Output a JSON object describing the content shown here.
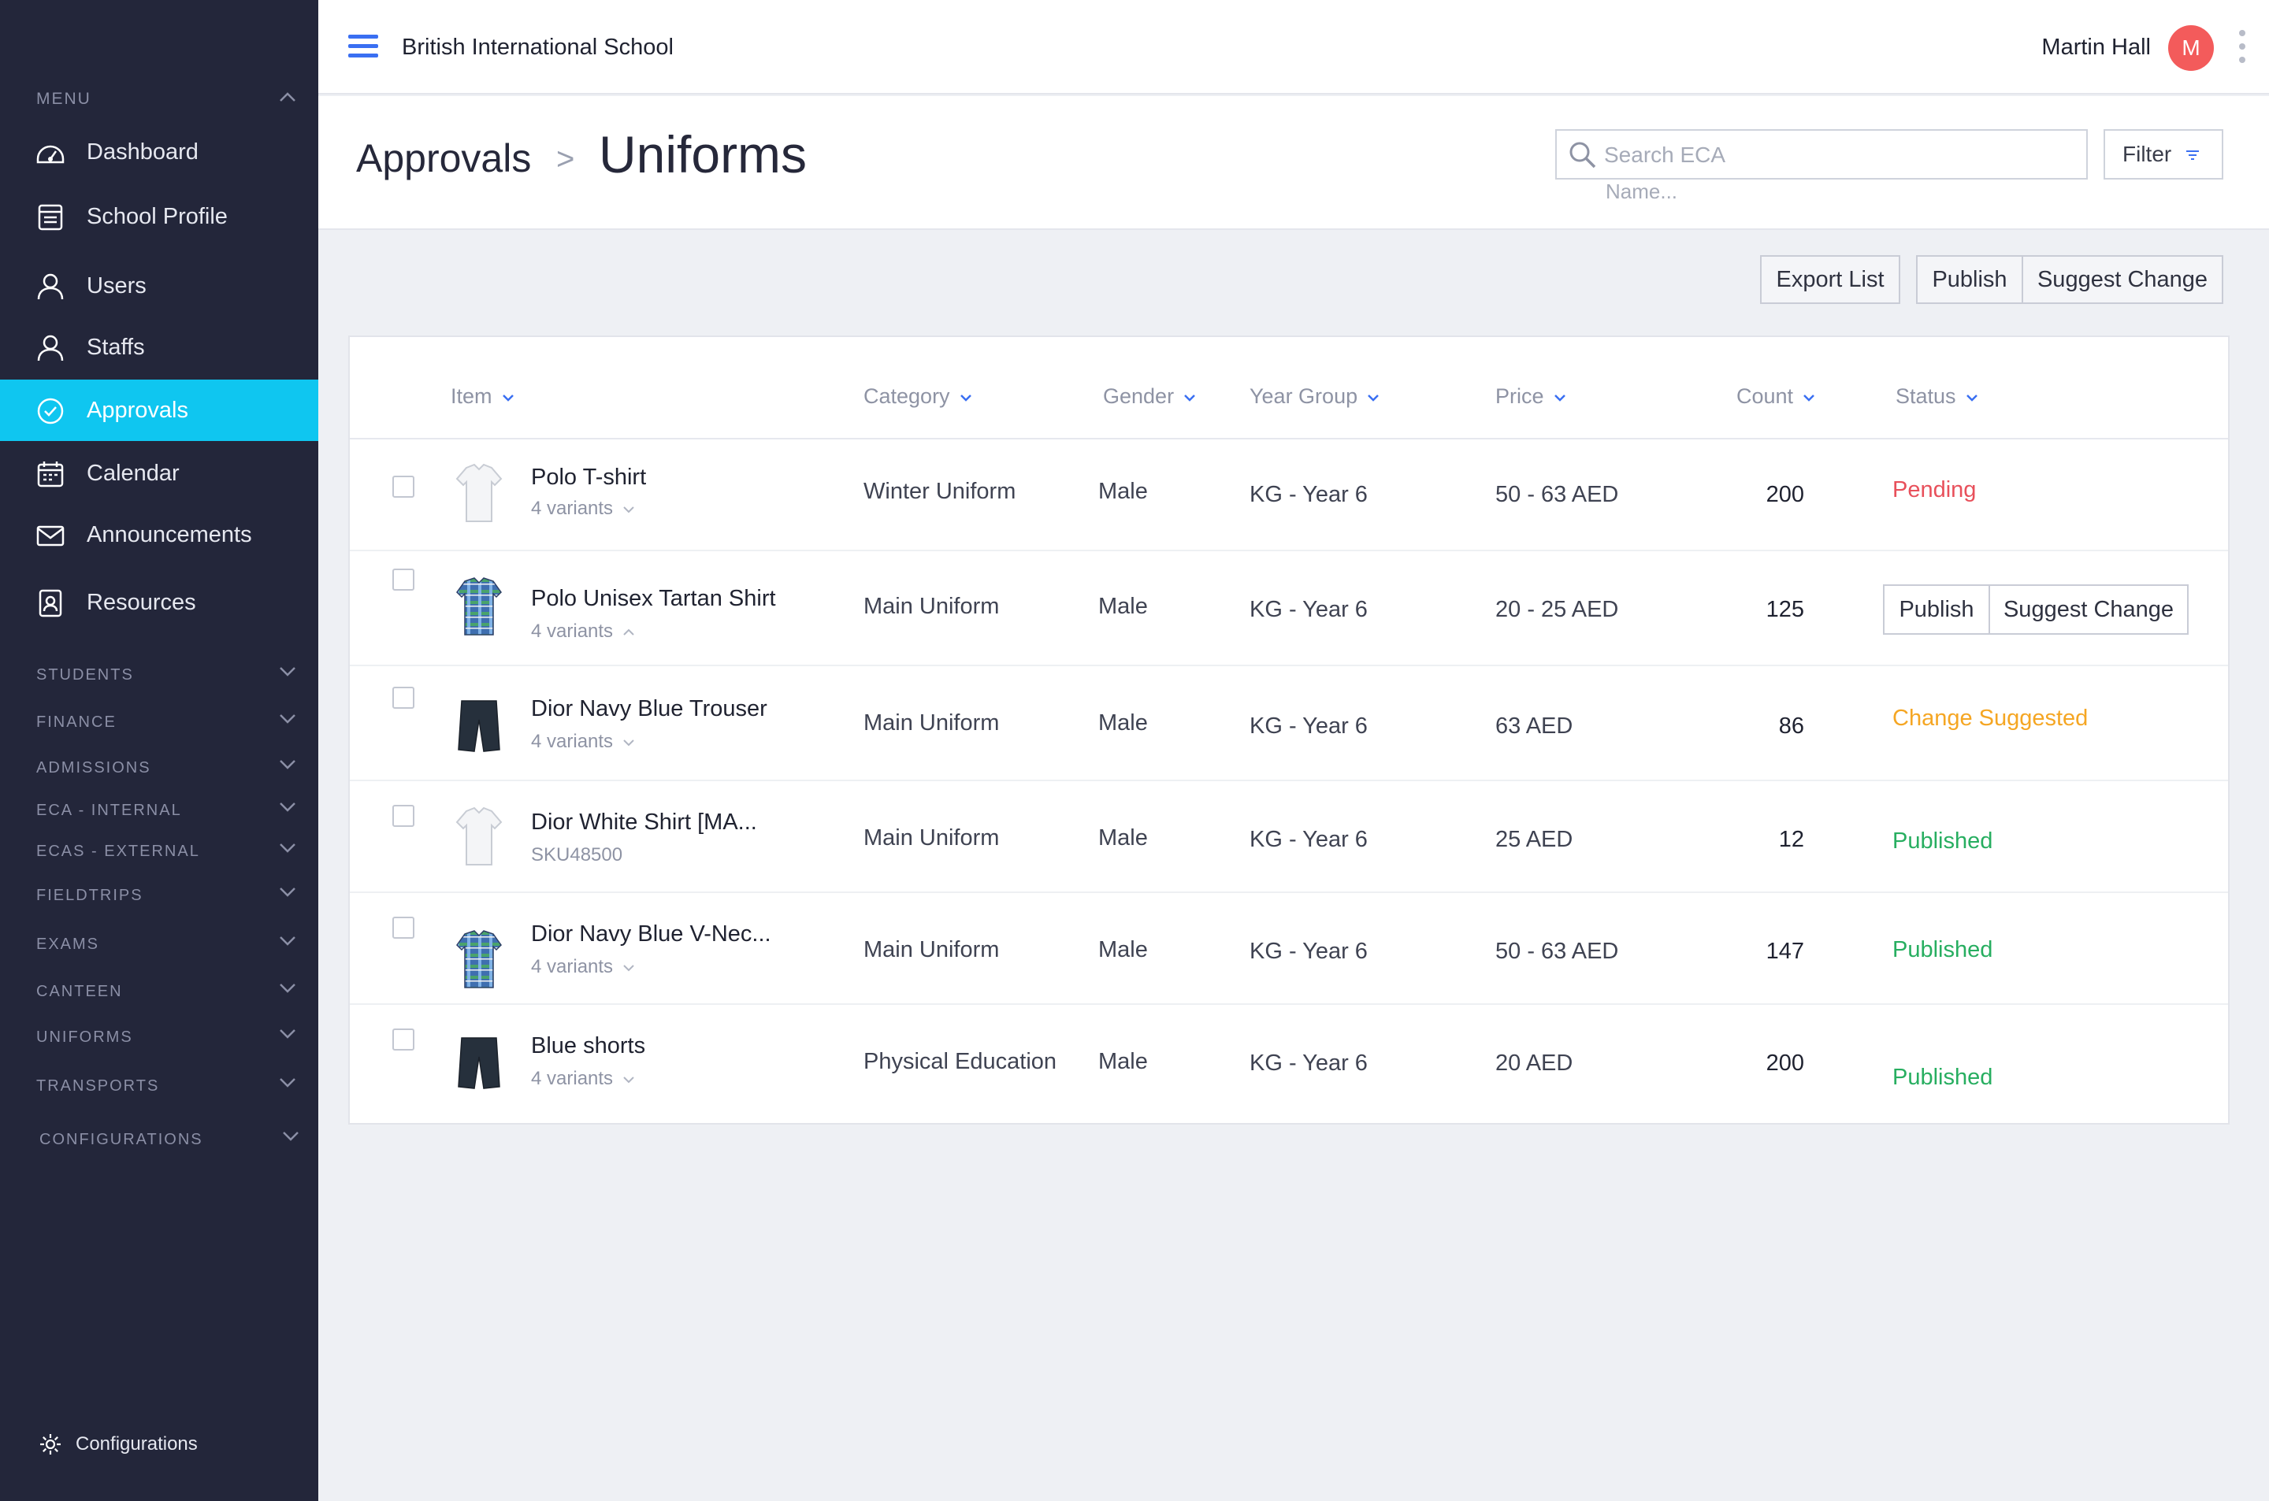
{
  "app": {
    "school_name": "British International School"
  },
  "user": {
    "name": "Martin Hall",
    "initial": "M"
  },
  "sidebar": {
    "menu_heading": "MENU",
    "items": [
      {
        "label": "Dashboard",
        "icon": "dashboard-icon"
      },
      {
        "label": "School Profile",
        "icon": "school-profile-icon"
      },
      {
        "label": "Users",
        "icon": "user-icon"
      },
      {
        "label": "Staffs",
        "icon": "staff-icon"
      },
      {
        "label": "Approvals",
        "icon": "check-circle-icon",
        "active": true
      },
      {
        "label": "Calendar",
        "icon": "calendar-icon"
      },
      {
        "label": "Announcements",
        "icon": "envelope-icon"
      },
      {
        "label": "Resources",
        "icon": "resources-icon"
      }
    ],
    "sections": [
      "STUDENTS",
      "FINANCE",
      "ADMISSIONS",
      "ECA - INTERNAL",
      "ECAS - EXTERNAL",
      "FIELDTRIPS",
      "EXAMS",
      "CANTEEN",
      "UNIFORMS",
      "TRANSPORTS",
      "CONFIGURATIONS"
    ],
    "footer_label": "Configurations"
  },
  "page": {
    "breadcrumb_parent": "Approvals",
    "breadcrumb_separator": ">",
    "title": "Uniforms",
    "search_placeholder": "Search ECA",
    "search_hint": "Name...",
    "filter_label": "Filter"
  },
  "actions": {
    "export": "Export List",
    "publish": "Publish",
    "suggest": "Suggest Change"
  },
  "table": {
    "columns": [
      "Item",
      "Category",
      "Gender",
      "Year Group",
      "Price",
      "Count",
      "Status"
    ],
    "rows": [
      {
        "name": "Polo T-shirt",
        "sub": "4 variants",
        "sub_chevron": "down",
        "thumb": "white-shirt",
        "category": "Winter Uniform",
        "gender": "Male",
        "year_group": "KG - Year 6",
        "price": "50 - 63 AED",
        "count": "200",
        "status": "Pending",
        "status_color": "#e8505b"
      },
      {
        "name": "Polo Unisex Tartan Shirt",
        "sub": "4 variants",
        "sub_chevron": "up",
        "thumb": "tartan-shirt",
        "category": "Main Uniform",
        "gender": "Male",
        "year_group": "KG - Year 6",
        "price": "20 - 25 AED",
        "count": "125",
        "status": "",
        "actions": {
          "publish": "Publish",
          "suggest": "Suggest Change"
        }
      },
      {
        "name": "Dior Navy Blue Trouser",
        "sub": "4 variants",
        "sub_chevron": "down",
        "thumb": "navy-shorts",
        "category": "Main Uniform",
        "gender": "Male",
        "year_group": "KG - Year 6",
        "price": "63 AED",
        "count": "86",
        "status": "Change Suggested",
        "status_color": "#f5a623"
      },
      {
        "name": "Dior White Shirt [MA...",
        "sub": "SKU48500",
        "sub_chevron": "",
        "thumb": "white-shirt",
        "category": "Main Uniform",
        "gender": "Male",
        "year_group": "KG - Year 6",
        "price": "25 AED",
        "count": "12",
        "status": "Published",
        "status_color": "#27ae60"
      },
      {
        "name": "Dior Navy Blue V-Nec...",
        "sub": "4 variants",
        "sub_chevron": "down",
        "thumb": "tartan-shirt",
        "category": "Main Uniform",
        "gender": "Male",
        "year_group": "KG - Year 6",
        "price": "50 - 63 AED",
        "count": "147",
        "status": "Published",
        "status_color": "#27ae60"
      },
      {
        "name": "Blue shorts",
        "sub": "4 variants",
        "sub_chevron": "down",
        "thumb": "navy-shorts",
        "category": "Physical Education",
        "gender": "Male",
        "year_group": "KG - Year 6",
        "price": "20 AED",
        "count": "200",
        "status": "Published",
        "status_color": "#27ae60"
      }
    ]
  },
  "colors": {
    "sidebar_bg": "#23263a",
    "accent": "#0fc6f0",
    "brand_blue": "#3a6ff2",
    "avatar_bg": "#f35b5b"
  }
}
